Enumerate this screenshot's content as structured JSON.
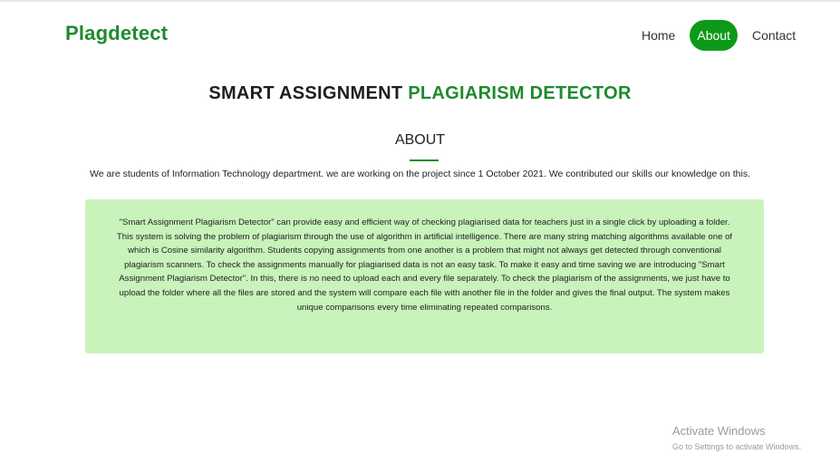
{
  "header": {
    "brand": "Plagdetect",
    "nav": {
      "home": "Home",
      "about": "About",
      "contact": "Contact"
    }
  },
  "hero": {
    "title_main": "SMART ASSIGNMENT ",
    "title_accent": "PLAGIARISM DETECTOR"
  },
  "about": {
    "heading": "ABOUT",
    "intro": "We are students of Information Technology department. we are working on the project since 1 October 2021. We contributed our skills our knowledge on this.",
    "body": "\"Smart Assignment Plagiarism Detector\" can provide easy and efficient way of checking plagiarised data for teachers just in a single click by uploading a folder. This system is solving the problem of plagiarism through the use of algorithm in artificial intelligence. There are many string matching algorithms available one of which is Cosine similarity algorithm. Students copying assignments from one another is a problem that might not always get detected through conventional plagiarism scanners. To check the assignments manually for plagiarised data is not an easy task. To make it easy and time saving we are introducing \"Smart Assignment Plagiarism Detector\". In this, there is no need to upload each and every file separately. To check the plagiarism of the assignments, we just have to upload the folder where all the files are stored and the system will compare each file with another file in the folder and gives the final output. The system makes unique comparisons every time eliminating repeated comparisons."
  },
  "watermark": {
    "title": "Activate Windows",
    "subtitle": "Go to Settings to activate Windows."
  },
  "colors": {
    "brand_green": "#1f8a2e",
    "nav_active": "#0d9a1a",
    "box_background": "#c8f3bb"
  }
}
